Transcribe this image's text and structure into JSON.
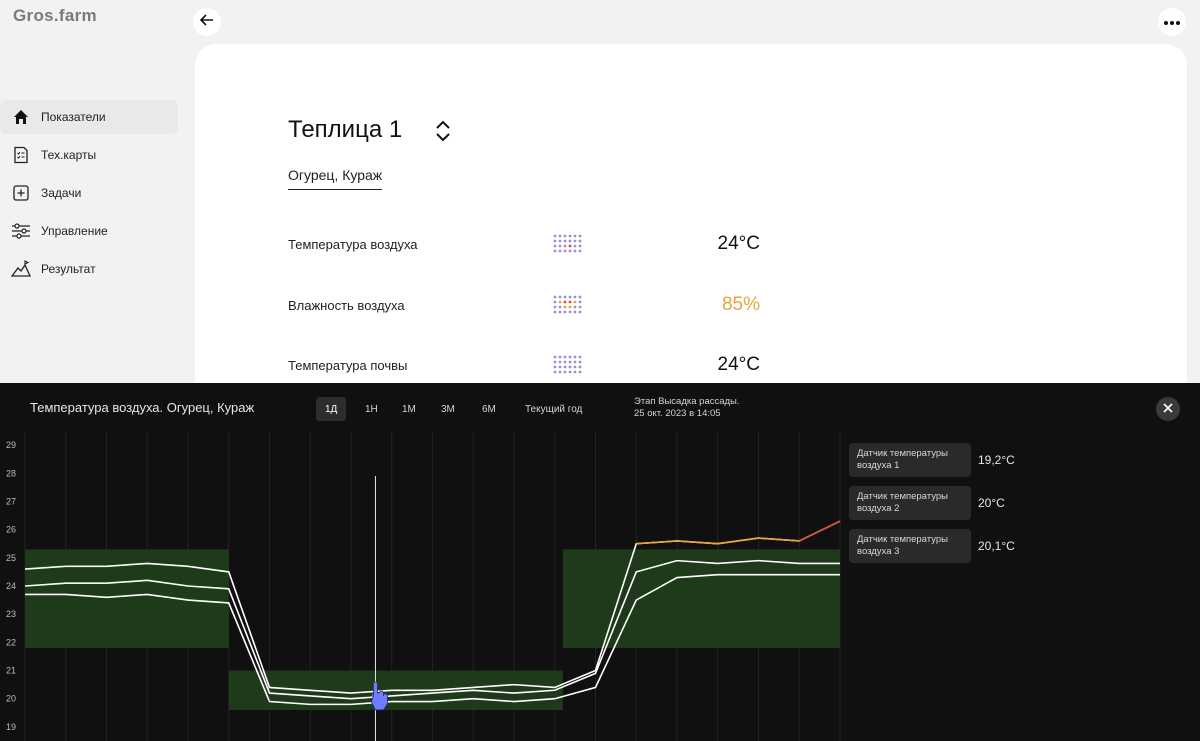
{
  "app": {
    "logo": "Gros.farm"
  },
  "sidebar": {
    "items": [
      {
        "label": "Показатели",
        "icon": "home-icon",
        "active": true
      },
      {
        "label": "Тех.карты",
        "icon": "checklist-icon"
      },
      {
        "label": "Задачи",
        "icon": "add-task-icon"
      },
      {
        "label": "Управление",
        "icon": "sliders-icon"
      },
      {
        "label": "Результат",
        "icon": "mountain-chart-icon"
      }
    ]
  },
  "header": {
    "back_icon": "arrow-left-icon",
    "more_icon": "more-dots-icon"
  },
  "greenhouse": {
    "title": "Теплица 1",
    "switch_icon": "chevron-updown-icon",
    "crop": "Огурец, Кураж",
    "metrics": [
      {
        "label": "Температура воздуха",
        "value": "24°C",
        "color": "#111111"
      },
      {
        "label": "Влажность воздуха",
        "value": "85%",
        "color": "#e8a33c"
      },
      {
        "label": "Температура почвы",
        "value": "24°C",
        "color": "#111111"
      }
    ]
  },
  "panel": {
    "title": "Температура воздуха. Огурец, Кураж",
    "ranges": [
      "1Д",
      "1Н",
      "1М",
      "3М",
      "6М",
      "Текущий год"
    ],
    "active_range": "1Д",
    "stage_line1": "Этап Высадка рассады.",
    "stage_line2": "25 окт. 2023  в 14:05",
    "close_icon": "close-icon"
  },
  "legend": [
    {
      "name_line1": "Датчик температуры",
      "name_line2": "воздуха 1",
      "value": "19,2°C"
    },
    {
      "name_line1": "Датчик температуры",
      "name_line2": "воздуха 2",
      "value": "20°C"
    },
    {
      "name_line1": "Датчик температуры",
      "name_line2": "воздуха 3",
      "value": "20,1°C"
    }
  ],
  "chart_data": {
    "type": "line",
    "yticks": [
      "29",
      "28",
      "27",
      "26",
      "25",
      "24",
      "23",
      "22",
      "21",
      "20",
      "19"
    ],
    "ylim": [
      18.5,
      29.5
    ],
    "x": [
      0,
      5,
      10,
      15,
      20,
      25,
      30,
      35,
      40,
      45,
      50,
      55,
      60,
      65,
      70,
      75,
      80,
      85,
      90,
      95,
      100
    ],
    "target_bands": [
      {
        "from": 0,
        "to": 25,
        "low": 21.8,
        "high": 25.3
      },
      {
        "from": 25,
        "to": 66,
        "low": 19.6,
        "high": 21.0
      },
      {
        "from": 66,
        "to": 100,
        "low": 21.8,
        "high": 25.3
      }
    ],
    "series": [
      {
        "values": [
          24.6,
          24.7,
          24.7,
          24.8,
          24.7,
          24.5,
          20.4,
          20.3,
          20.2,
          20.3,
          20.3,
          20.4,
          20.5,
          20.4,
          21.0,
          25.5,
          25.6,
          25.5,
          25.7,
          25.6,
          26.3
        ]
      },
      {
        "values": [
          24.0,
          24.1,
          24.1,
          24.2,
          24.0,
          23.9,
          20.2,
          20.1,
          20.0,
          20.1,
          20.2,
          20.3,
          20.2,
          20.3,
          20.9,
          24.5,
          24.9,
          24.8,
          24.9,
          24.8,
          24.8
        ]
      },
      {
        "values": [
          23.7,
          23.7,
          23.6,
          23.7,
          23.5,
          23.4,
          19.9,
          19.8,
          19.8,
          19.9,
          19.9,
          20.0,
          19.9,
          20.0,
          20.4,
          23.5,
          24.3,
          24.4,
          24.4,
          24.4,
          24.4
        ]
      }
    ],
    "cursor_x": 43
  }
}
